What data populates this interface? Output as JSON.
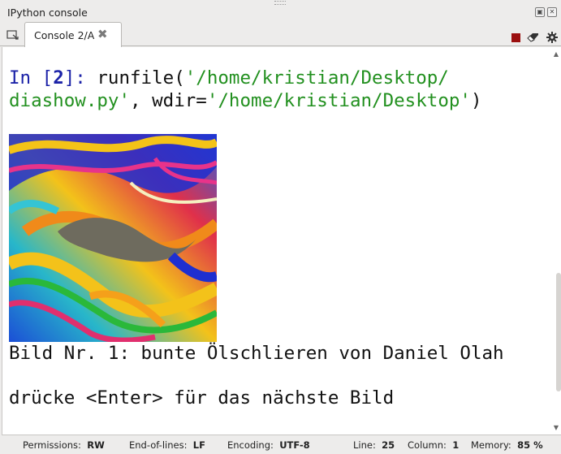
{
  "pane": {
    "title": "IPython console"
  },
  "tabs": [
    {
      "label": "Console 2/A",
      "active": true
    }
  ],
  "toolbar": {
    "icons": [
      "stop-icon",
      "eraser-icon",
      "gear-icon"
    ],
    "stop_color": "#9b0f0f"
  },
  "console": {
    "input": {
      "prompt_in": "In [",
      "prompt_number": "2",
      "prompt_close": "]: ",
      "call_start": "runfile(",
      "path_part1": "'/home/kristian/Desktop/",
      "path_part2": "diashow.py'",
      "separator": ", wdir=",
      "wdir_value": "'/home/kristian/Desktop'",
      "call_end": ")"
    },
    "image_label": "swirling oil film image",
    "output_lines": [
      "Bild Nr. 1: bunte Ölschlieren von Daniel Olah",
      "drücke <Enter> für das nächste Bild"
    ],
    "colors": {
      "prompt": "#1c23a8",
      "string": "#22901f",
      "text": "#111111"
    }
  },
  "status": {
    "permissions_label": "Permissions:",
    "permissions_value": "RW",
    "eol_label": "End-of-lines:",
    "eol_value": "LF",
    "encoding_label": "Encoding:",
    "encoding_value": "UTF-8",
    "line_label": "Line:",
    "line_value": "25",
    "column_label": "Column:",
    "column_value": "1",
    "memory_label": "Memory:",
    "memory_value": "85 %"
  }
}
